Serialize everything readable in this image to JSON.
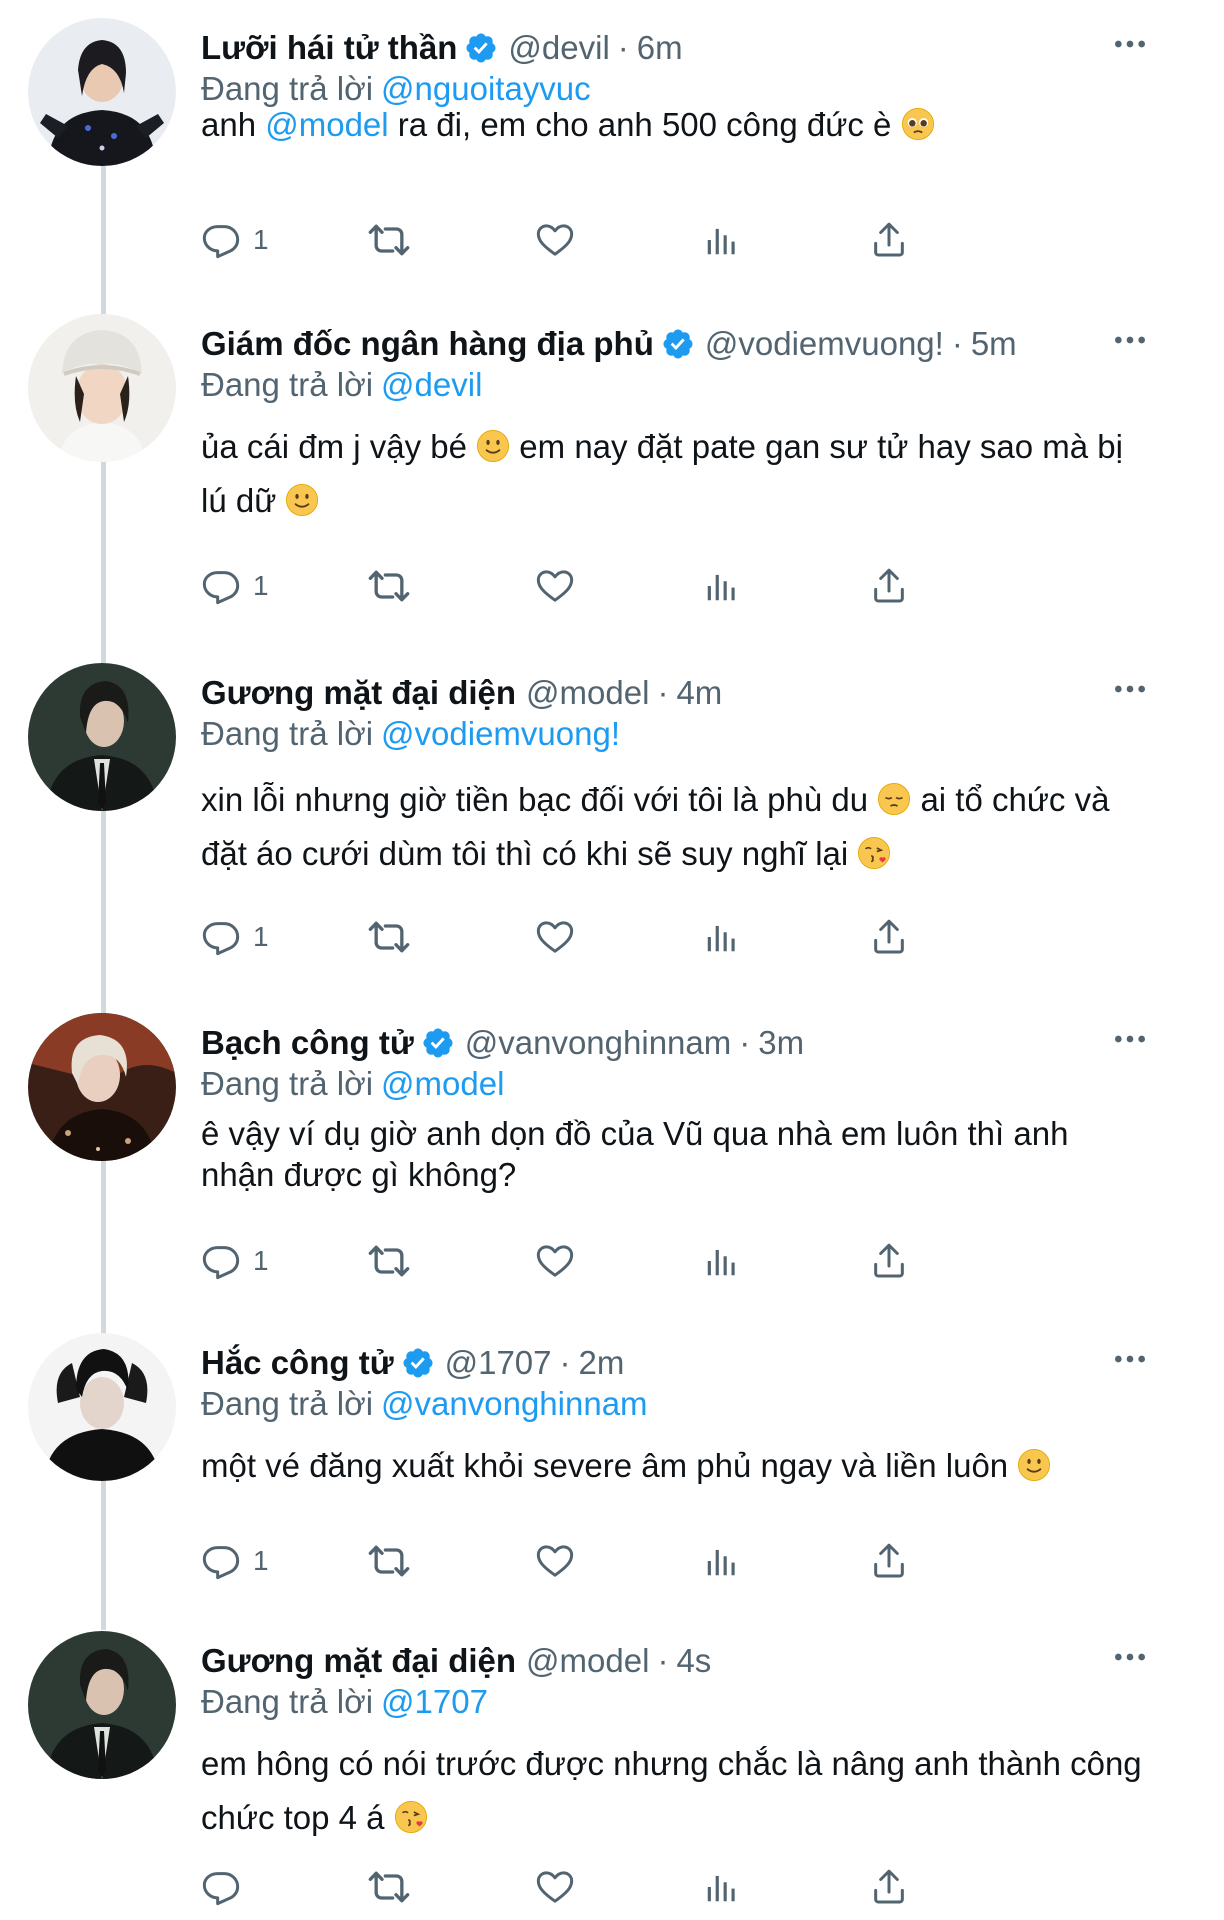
{
  "colors": {
    "link": "#1d9bf0",
    "muted": "#536471",
    "text": "#0f1419",
    "verified": "#1d9bf0"
  },
  "tweets": [
    {
      "name": "Lưỡi hái tử thần",
      "verified": true,
      "handle": "@devil",
      "sep": "·",
      "time": "6m",
      "reply_prefix": "Đang trả lời",
      "reply_to": "@nguoitayvuc",
      "text_before": "anh ",
      "mention": "@model",
      "text_after": " ra đi, em cho anh 500 công đức è",
      "emoji": "pleading-face-emoji",
      "reply_count": "1"
    },
    {
      "name": "Giám đốc ngân hàng địa phủ",
      "verified": true,
      "handle": "@vodiemvuong!",
      "sep": "·",
      "time": "5m",
      "reply_prefix": "Đang trả lời",
      "reply_to": "@devil",
      "text_line1": "ủa cái đm j vậy bé ",
      "text_line1b": " em nay đặt pate gan sư tử hay sao mà bị",
      "text_line2": "lú dữ ",
      "emoji": "slightly-smiling-face-emoji",
      "reply_count": "1"
    },
    {
      "name": "Gương mặt đại diện",
      "verified": false,
      "handle": "@model",
      "sep": "·",
      "time": "4m",
      "reply_prefix": "Đang trả lời",
      "reply_to": "@vodiemvuong!",
      "text_line1": "xin lỗi nhưng giờ tiền bạc đối với tôi là phù du ",
      "text_line1b": " ai tổ chức và",
      "text_line2": "đặt áo cưới dùm tôi thì có khi sẽ suy nghĩ lại ",
      "emoji": "pensive-face-emoji",
      "emoji2": "face-blowing-kiss-emoji",
      "reply_count": "1"
    },
    {
      "name": "Bạch công tử",
      "verified": true,
      "handle": "@vanvonghinnam",
      "sep": "·",
      "time": "3m",
      "reply_prefix": "Đang trả lời",
      "reply_to": "@model",
      "text_line1": "ê vậy ví dụ giờ anh dọn đồ của Vũ qua nhà em luôn thì anh",
      "text_line2": "nhận được gì không?",
      "reply_count": "1"
    },
    {
      "name": "Hắc công tử",
      "verified": true,
      "handle": "@1707",
      "sep": "·",
      "time": "2m",
      "reply_prefix": "Đang trả lời",
      "reply_to": "@vanvonghinnam",
      "text_line1": "một vé đăng xuất khỏi severe âm phủ ngay và liền luôn ",
      "emoji": "slightly-smiling-face-emoji",
      "reply_count": "1"
    },
    {
      "name": "Gương mặt đại diện",
      "verified": false,
      "handle": "@model",
      "sep": "·",
      "time": "4s",
      "reply_prefix": "Đang trả lời",
      "reply_to": "@1707",
      "text_line1": "em hông có nói trước được nhưng chắc là nâng anh thành công",
      "text_line2": "chức top 4 á ",
      "emoji": "face-blowing-kiss-emoji",
      "reply_count": ""
    }
  ]
}
